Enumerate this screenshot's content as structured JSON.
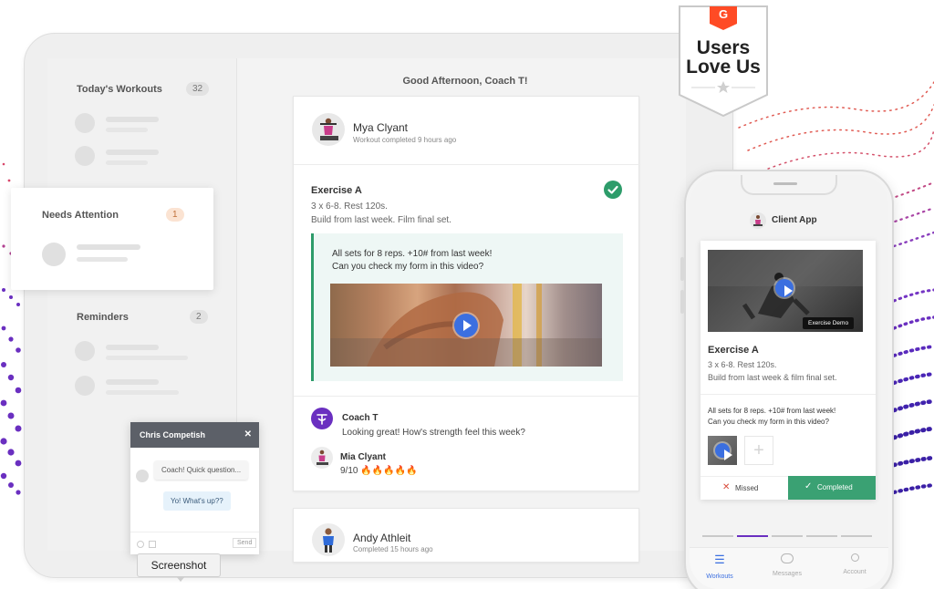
{
  "dashboard": {
    "greeting": "Good Afternoon, Coach T!",
    "sidebar": {
      "todays_workouts": {
        "label": "Today's Workouts",
        "count": "32"
      },
      "needs_attention": {
        "label": "Needs Attention",
        "count": "1"
      },
      "reminders": {
        "label": "Reminders",
        "count": "2"
      }
    },
    "feed": [
      {
        "name": "Mya Clyant",
        "status": "Workout completed 9 hours ago",
        "exercise_title": "Exercise A",
        "exercise_line1": "3 x 6-8. Rest 120s.",
        "exercise_line2": "Build from last week. Film final set.",
        "client_note_line1": "All sets for 8 reps. +10# from last week!",
        "client_note_line2": "Can you check my form in this video?",
        "comments": [
          {
            "author": "Coach T",
            "text": "Looking great! How's strength feel this week?"
          },
          {
            "author": "Mia Clyant",
            "text": "9/10 🔥🔥🔥🔥🔥"
          }
        ]
      },
      {
        "name": "Andy Athleit",
        "status": "Completed 15 hours ago"
      }
    ]
  },
  "chat": {
    "title": "Chris Competish",
    "close": "✕",
    "messages": [
      {
        "text": "Coach! Quick question..."
      },
      {
        "text": "Yo! What's up??"
      }
    ],
    "send": "Send"
  },
  "tooltip": {
    "label": "Screenshot"
  },
  "badge": {
    "brand": "G",
    "line1": "Users",
    "line2": "Love Us"
  },
  "phone": {
    "title": "Client App",
    "video_label": "Exercise Demo",
    "exercise_title": "Exercise A",
    "exercise_line1": "3 x 6-8. Rest 120s.",
    "exercise_line2": "Build from last week & film final set.",
    "note_line1": "All sets for 8 reps. +10# from last week!",
    "note_line2": "Can you check my form in this video?",
    "add": "+",
    "missed": "Missed",
    "completed": "Completed",
    "tabs": [
      {
        "label": "Workouts"
      },
      {
        "label": "Messages"
      },
      {
        "label": "Account"
      }
    ]
  },
  "colors": {
    "green": "#2d9c6a",
    "purple": "#6a2fc0",
    "play_blue": "#3b6fe0",
    "g2_orange": "#ff4b25",
    "attention_orange": "#e58a4b"
  }
}
